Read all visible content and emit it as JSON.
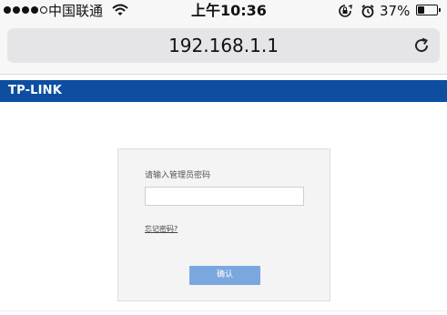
{
  "status_bar": {
    "carrier": "中国联通",
    "time": "上午10:36",
    "battery_percent": "37%",
    "battery_level": 0.37,
    "signal_bars_filled": 4,
    "signal_bars_total": 5,
    "icons": [
      "wifi-icon",
      "rotation-lock-icon",
      "alarm-icon",
      "battery-icon"
    ]
  },
  "browser": {
    "url": "192.168.1.1",
    "reload_icon": "reload-icon"
  },
  "header": {
    "brand": "TP-LINK",
    "brand_color": "#0d4ea0"
  },
  "login": {
    "password_label": "请输入管理员密码",
    "password_value": "",
    "forgot_link": "忘记密码?",
    "confirm_button": "确认",
    "button_color": "#7ba7df"
  }
}
